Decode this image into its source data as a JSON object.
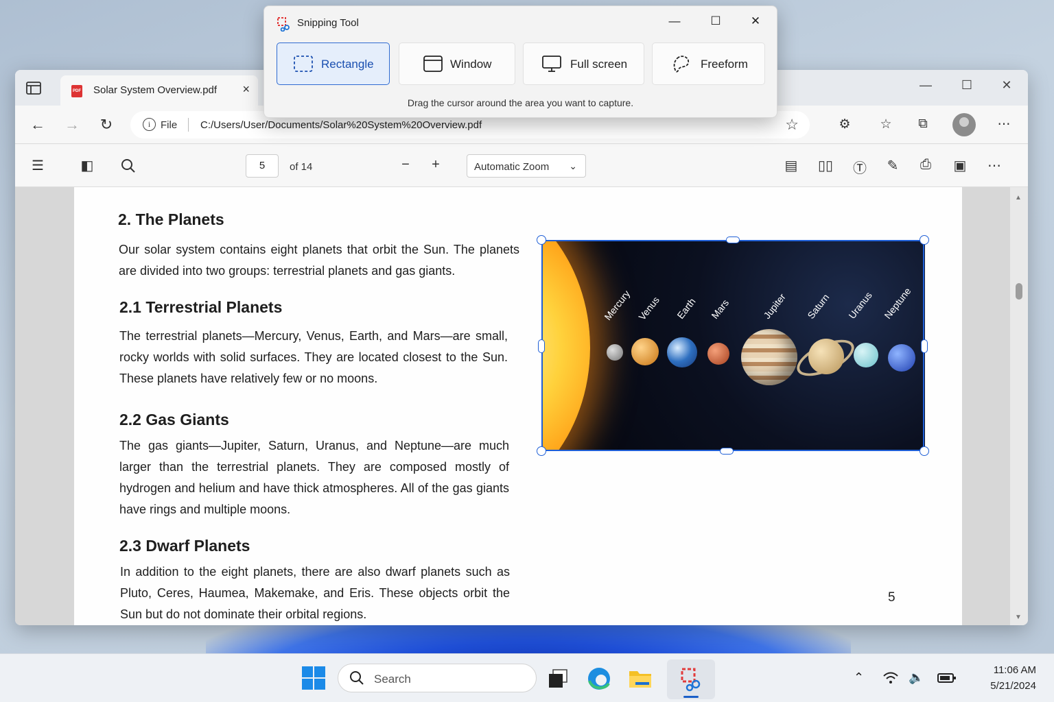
{
  "snipping_tool": {
    "title": "Snipping Tool",
    "modes": [
      {
        "label": "Rectangle",
        "active": true
      },
      {
        "label": "Window",
        "active": false
      },
      {
        "label": "Full screen",
        "active": false
      },
      {
        "label": "Freeform",
        "active": false
      }
    ],
    "hint": "Drag the cursor around the area you want to capture."
  },
  "browser": {
    "tab_title": "Solar System Overview.pdf",
    "file_label": "File",
    "url": "C:/Users/User/Documents/Solar%20System%20Overview.pdf"
  },
  "pdf_toolbar": {
    "page_number": "5",
    "page_total": "of 14",
    "zoom": "Automatic Zoom"
  },
  "document": {
    "h_planets": "2.  The Planets",
    "p_planets": "Our solar system contains eight planets that orbit the Sun. The planets are divided into two groups: terrestrial planets and gas giants.",
    "h_terrestrial": "2.1 Terrestrial Planets",
    "p_terrestrial": "The terrestrial planets—Mercury, Venus, Earth, and Mars—are small, rocky worlds with solid surfaces. They are located closest to the Sun. These planets have relatively few or no moons.",
    "h_gas": "2.2 Gas Giants",
    "p_gas": "The gas giants—Jupiter, Saturn, Uranus, and Neptune—are much larger than the terrestrial planets. They are composed mostly of hydrogen and helium and have thick atmospheres. All of the gas giants have rings and multiple moons.",
    "h_dwarf": "2.3 Dwarf Planets",
    "p_dwarf": "In addition to the eight planets, there are also dwarf planets such as Pluto, Ceres, Haumea, Makemake, and Eris. These objects orbit the Sun but do not dominate their orbital regions.",
    "page_footer": "5",
    "figure_planets": [
      "Mercury",
      "Venus",
      "Earth",
      "Mars",
      "Jupiter",
      "Saturn",
      "Uranus",
      "Neptune"
    ]
  },
  "taskbar": {
    "search_placeholder": "Search",
    "time": "11:06 AM",
    "date": "5/21/2024"
  },
  "colors": {
    "accent": "#2e6ad1",
    "selection": "#1f5fd6"
  }
}
